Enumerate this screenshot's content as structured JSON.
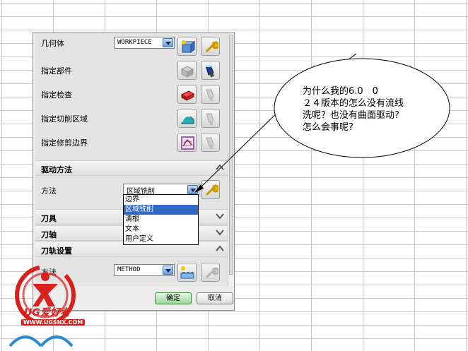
{
  "geometry": {
    "label": "几何体",
    "value": "WORKPIECE",
    "specify_part": "指定部件",
    "specify_check": "指定检查",
    "specify_cut_area": "指定切削区域",
    "specify_trim_boundary": "指定修剪边界"
  },
  "drive_method": {
    "section_title": "驱动方法",
    "method_label": "方法",
    "method_value": "区域铣削",
    "options": [
      "边界",
      "区域铣削",
      "清根",
      "文本",
      "用户定义"
    ]
  },
  "sections": {
    "tool": "刀具",
    "tool_axis": "刀轴",
    "path_settings": "刀轨设置"
  },
  "path_settings": {
    "method_label": "方法",
    "method_value": "METHOD"
  },
  "buttons": {
    "ok": "确定",
    "cancel": "取消"
  },
  "callout": {
    "lines": [
      "为什么我的6.0　0",
      "２４版本的怎么没有流线",
      "洗呢？也没有曲面驱动?",
      "怎么会事呢?"
    ]
  },
  "logo": {
    "brand": "UG爱好者",
    "url": "WWW.UGSNX.COM"
  }
}
